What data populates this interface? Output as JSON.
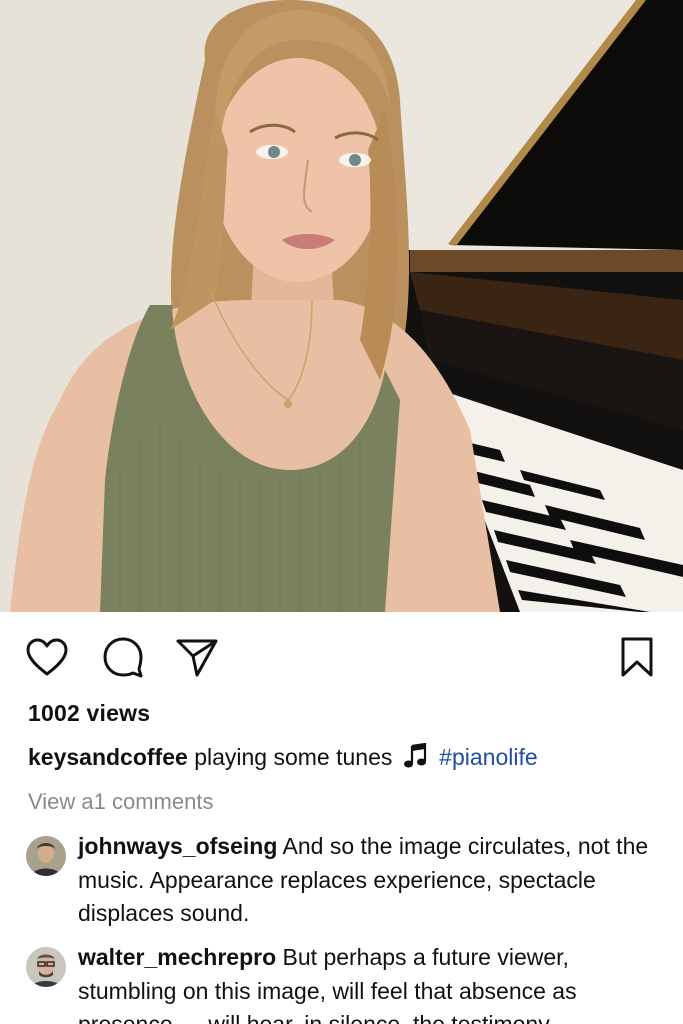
{
  "post": {
    "views": "1002 views",
    "caption": {
      "username": "keysandcoffee",
      "text": "playing some tunes",
      "hashtag": "#pianolife"
    },
    "view_comments": "View a1 comments"
  },
  "comments": [
    {
      "username": "johnways_ofseing",
      "text": "And so the image circulates, not the music. Appearance replaces experience, spectacle displaces sound."
    },
    {
      "username": "walter_mechrepro",
      "text": "But perhaps a future viewer, stumbling on this image, will feel that absence as presence — will hear, in silence, the testimony"
    }
  ],
  "icons": {
    "like": "heart-icon",
    "comment": "comment-bubble-icon",
    "share": "paper-plane-icon",
    "save": "bookmark-icon",
    "music": "music-note-icon"
  },
  "colors": {
    "hashtag": "#1f4e9e",
    "muted": "#8a8a8a",
    "text": "#111111"
  }
}
